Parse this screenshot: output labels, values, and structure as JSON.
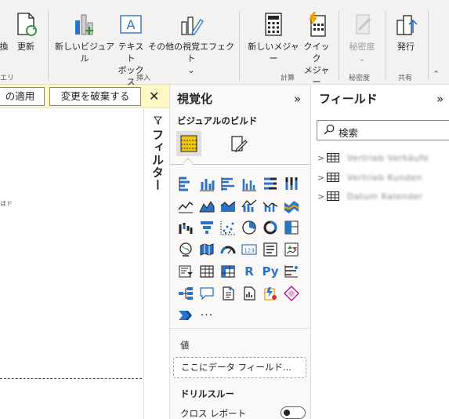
{
  "ribbon": {
    "buttons": [
      {
        "id": "transform",
        "label": "換"
      },
      {
        "id": "refresh",
        "label": "更新"
      },
      {
        "id": "new-visual",
        "label": "新しいビジュアル"
      },
      {
        "id": "textbox",
        "label": "テキスト\nボックス"
      },
      {
        "id": "more-visuals",
        "label": "その他の視覚エフェクト",
        "caret": "⌄"
      },
      {
        "id": "new-measure",
        "label": "新しいメジャー"
      },
      {
        "id": "quick-measure",
        "label": "クイック\nメジャー"
      },
      {
        "id": "sensitivity",
        "label": "秘密度",
        "caret": "⌄"
      },
      {
        "id": "publish",
        "label": "発行"
      }
    ],
    "groups": {
      "query": "エリ",
      "insert": "挿入",
      "calc": "計算",
      "sensitivity": "秘密度",
      "share": "共有"
    }
  },
  "infobar": {
    "apply": "の適用",
    "discard": "変更を破棄する",
    "close": "✕"
  },
  "canvas": {
    "note": "ほド"
  },
  "filters": {
    "label": "フィルター",
    "icon": "funnel-icon"
  },
  "viz": {
    "title": "視覚化",
    "collapse": "»",
    "build_label": "ビジュアルのビルド",
    "values_label": "値",
    "drop_placeholder": "ここにデータ フィールド...",
    "drill_label": "ドリルスルー",
    "cross_report": "クロス レポート",
    "cross_report_on": false,
    "text_icons": {
      "r": "R",
      "py": "Py",
      "more": "···"
    }
  },
  "fields": {
    "title": "フィールド",
    "collapse": "»",
    "search_placeholder": "検索",
    "tables": [
      "Vertrieb Verkäufe",
      "Vertrieb Kunden",
      "Datum Kalender"
    ]
  },
  "colors": {
    "accent_blue": "#2b73c6",
    "accent_yellow": "#f2c811",
    "infobar_bg": "#fff8c5",
    "ribbon_bg": "#f3f2f1"
  }
}
